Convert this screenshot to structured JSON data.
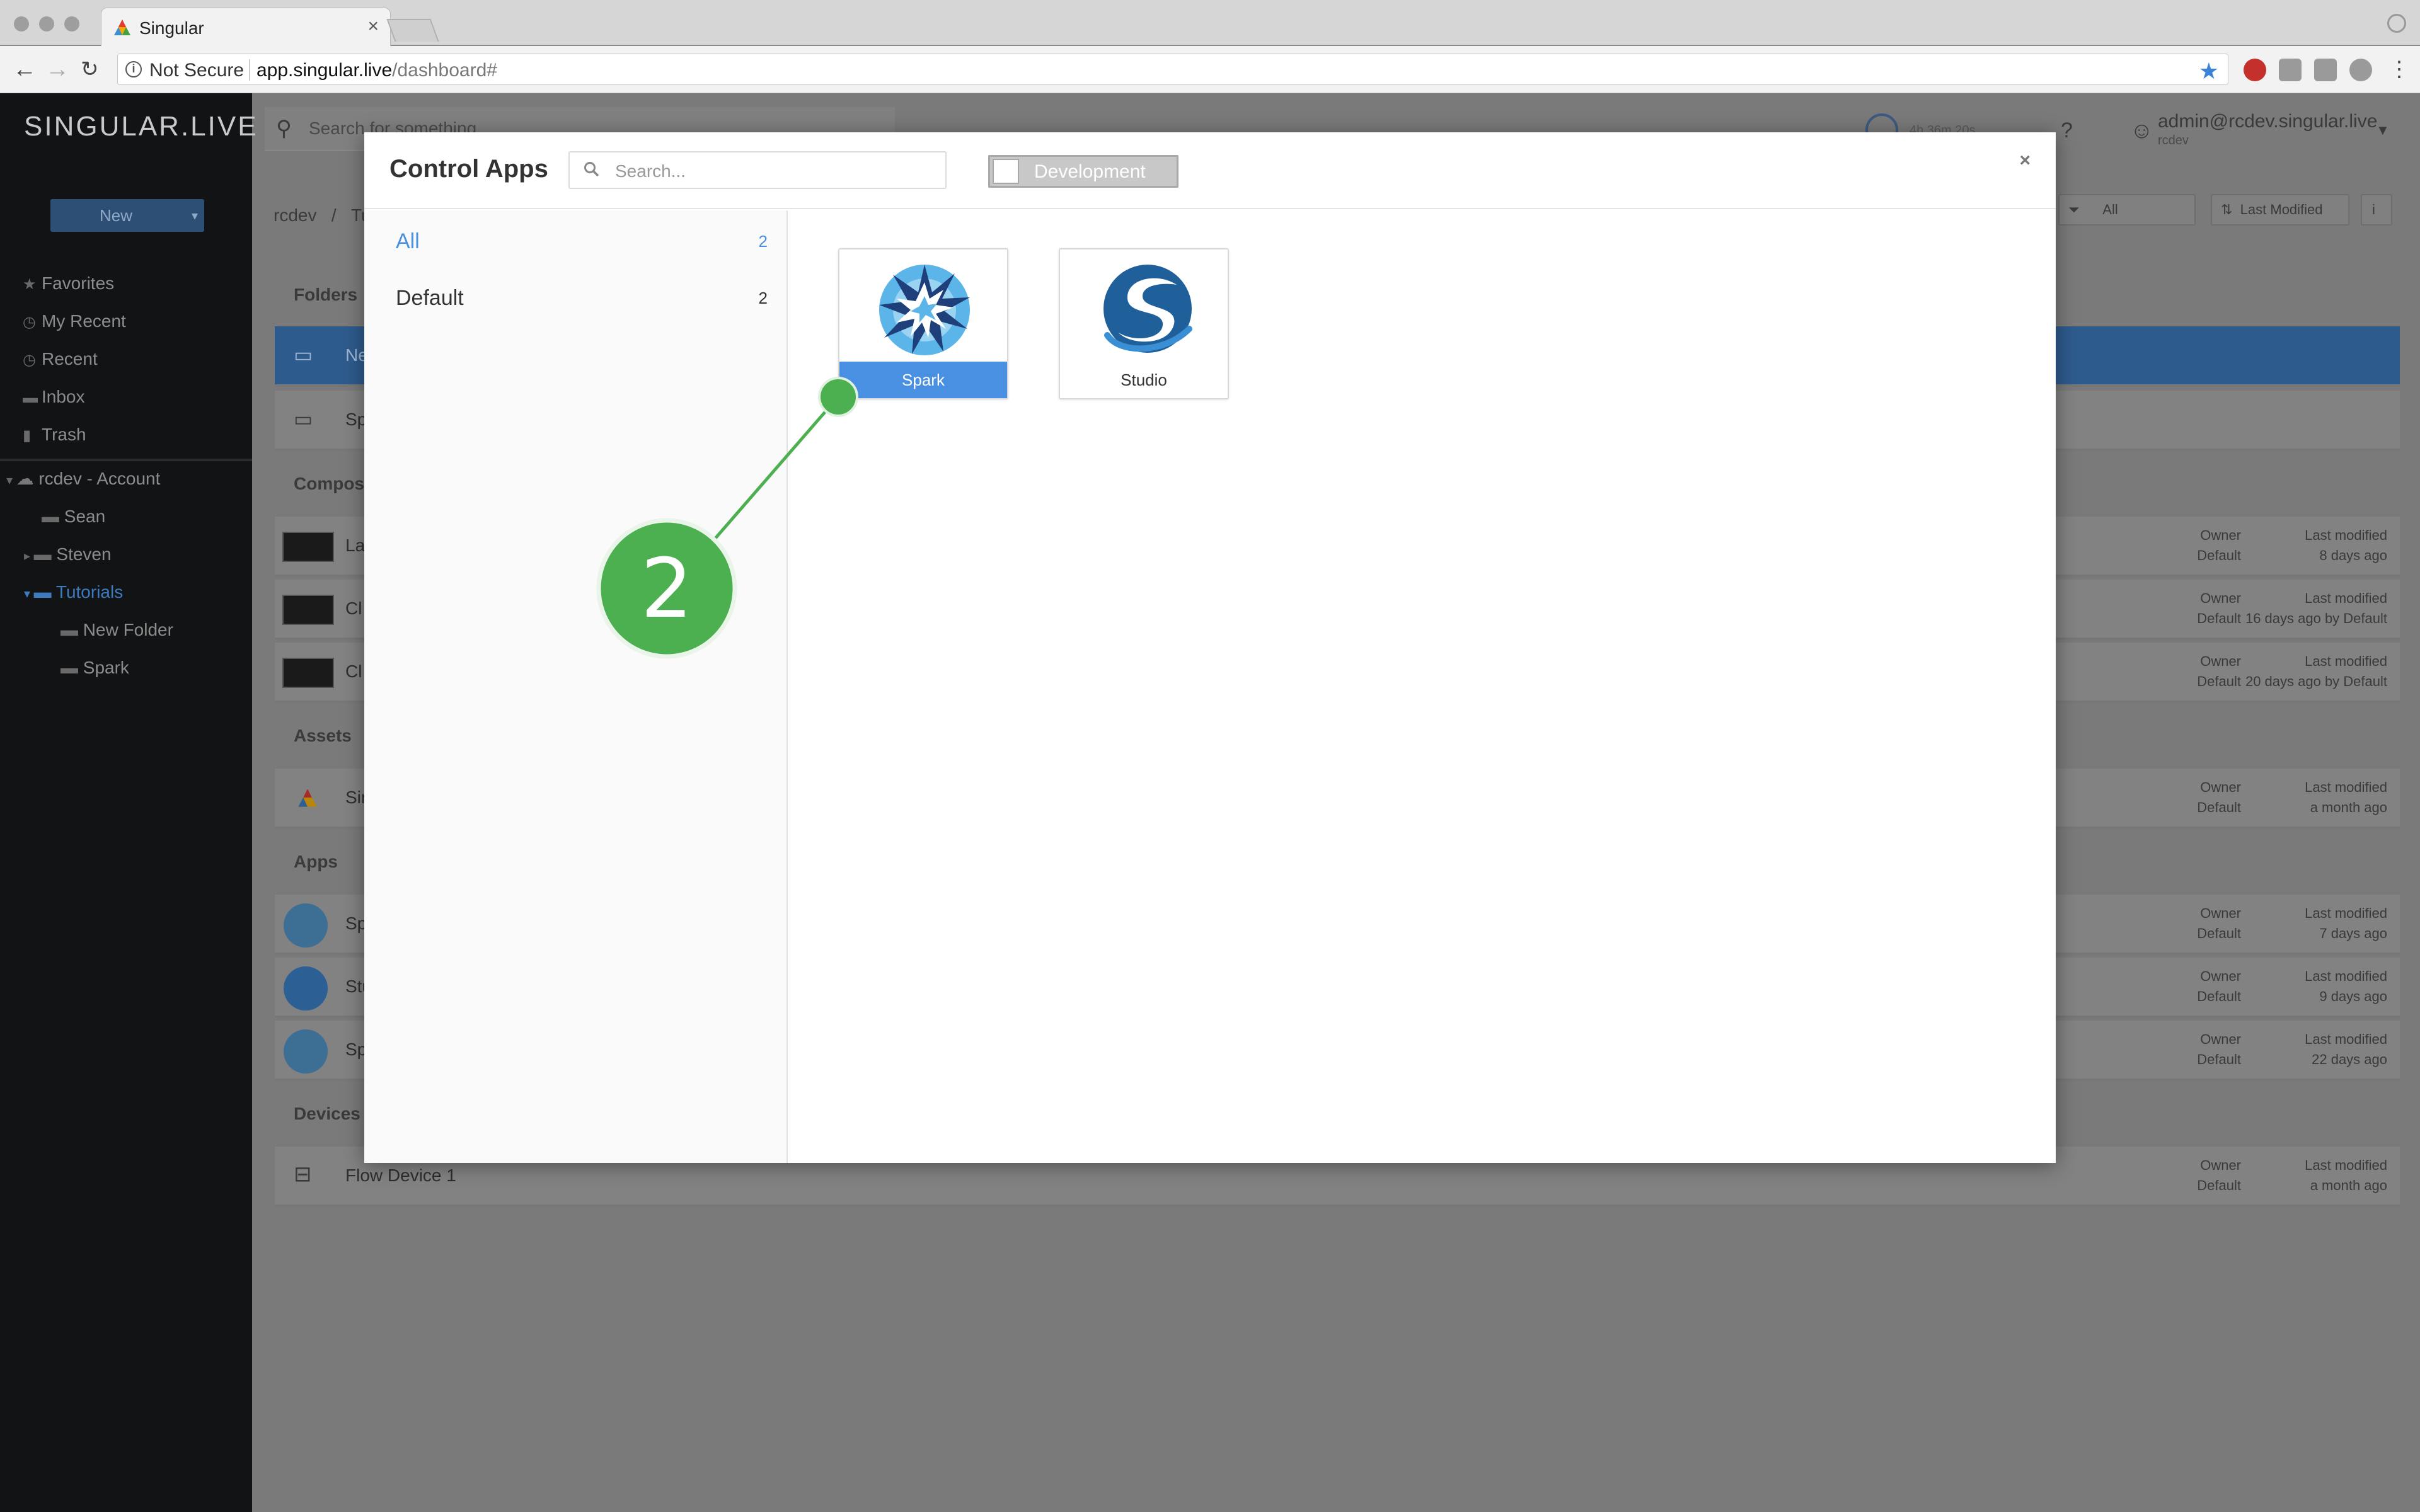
{
  "browser": {
    "tab_title": "Singular",
    "tab_close": "×",
    "security_label": "Not Secure",
    "url_host": "app.singular.live",
    "url_path": "/dashboard#"
  },
  "app": {
    "brand": "SINGULAR.LIVE",
    "new_button": "New",
    "search_placeholder": "Search for something",
    "timer": "4h 36m 20s",
    "user_email": "admin@rcdev.singular.live",
    "user_account": "rcdev",
    "breadcrumb_root": "rcdev",
    "breadcrumb_sep": "/",
    "breadcrumb_current": "Tu",
    "filter_value": "All",
    "sort_value": "Last Modified",
    "info_button": "i"
  },
  "sidebar": {
    "items": [
      {
        "label": "Favorites",
        "icon": "star-icon"
      },
      {
        "label": "My Recent",
        "icon": "clock-icon"
      },
      {
        "label": "Recent",
        "icon": "clock-icon"
      },
      {
        "label": "Inbox",
        "icon": "folder-icon"
      },
      {
        "label": "Trash",
        "icon": "trash-icon"
      }
    ],
    "account": "rcdev - Account",
    "tree": [
      {
        "label": "Sean"
      },
      {
        "label": "Steven"
      },
      {
        "label": "Tutorials"
      },
      {
        "label": "New Folder"
      },
      {
        "label": "Spark"
      }
    ]
  },
  "main": {
    "sections": {
      "folders": "Folders",
      "compositions": "Composi",
      "assets": "Assets",
      "apps": "Apps",
      "devices": "Devices"
    },
    "folder_rows": [
      {
        "name": "Ne"
      },
      {
        "name": "Sp"
      }
    ],
    "composition_rows": [
      {
        "name": "La",
        "owner_label": "Owner",
        "owner": "Default",
        "mod_label": "Last modified",
        "modified": "8 days ago"
      },
      {
        "name": "Cl",
        "owner_label": "Owner",
        "owner": "Default",
        "mod_label": "Last modified",
        "modified": "16 days ago by Default"
      },
      {
        "name": "Cl",
        "owner_label": "Owner",
        "owner": "Default",
        "mod_label": "Last modified",
        "modified": "20 days ago by Default"
      }
    ],
    "asset_rows": [
      {
        "name": "Sir",
        "owner_label": "Owner",
        "owner": "Default",
        "mod_label": "Last modified",
        "modified": "a month ago"
      }
    ],
    "app_rows": [
      {
        "name": "Sp",
        "owner_label": "Owner",
        "owner": "Default",
        "mod_label": "Last modified",
        "modified": "7 days ago"
      },
      {
        "name": "Stu",
        "owner_label": "Owner",
        "owner": "Default",
        "mod_label": "Last modified",
        "modified": "9 days ago"
      },
      {
        "name": "Sp",
        "owner_label": "Owner",
        "owner": "Default",
        "mod_label": "Last modified",
        "modified": "22 days ago"
      }
    ],
    "device_rows": [
      {
        "name": "Flow Device 1",
        "owner_label": "Owner",
        "owner": "Default",
        "mod_label": "Last modified",
        "modified": "a month ago"
      }
    ]
  },
  "modal": {
    "title": "Control Apps",
    "search_placeholder": "Search...",
    "toggle_label": "Development",
    "close": "×",
    "categories": [
      {
        "name": "All",
        "count": "2",
        "active": true
      },
      {
        "name": "Default",
        "count": "2",
        "active": false
      }
    ],
    "apps": [
      {
        "name": "Spark",
        "selected": true,
        "icon": "spark-logo-icon"
      },
      {
        "name": "Studio",
        "selected": false,
        "icon": "studio-logo-icon"
      }
    ]
  },
  "annotation": {
    "step_number": "2",
    "color": "#4caf50"
  },
  "colors": {
    "accent_blue": "#4a90e2",
    "sidebar_bg": "#111315",
    "active_link": "#3d7ac0"
  }
}
